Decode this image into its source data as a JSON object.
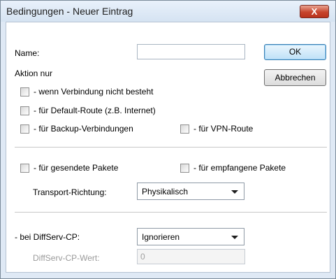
{
  "window": {
    "title": "Bedingungen - Neuer Eintrag",
    "close_label": "X"
  },
  "form": {
    "name_label": "Name:",
    "name_value": "",
    "ok_label": "OK",
    "cancel_label": "Abbrechen",
    "action_heading": "Aktion nur",
    "checks": {
      "no_connection": {
        "label": "- wenn Verbindung nicht besteht",
        "checked": false
      },
      "default_route": {
        "label": "- für Default-Route (z.B. Internet)",
        "checked": false
      },
      "backup": {
        "label": "- für Backup-Verbindungen",
        "checked": false
      },
      "vpn_route": {
        "label": "- für VPN-Route",
        "checked": false
      },
      "sent": {
        "label": "- für gesendete Pakete",
        "checked": false
      },
      "received": {
        "label": "- für empfangene Pakete",
        "checked": false
      }
    },
    "transport_label": "Transport-Richtung:",
    "transport_value": "Physikalisch",
    "diffserv_label": "- bei DiffServ-CP:",
    "diffserv_value": "Ignorieren",
    "diffserv_value_label": "DiffServ-CP-Wert:",
    "diffserv_value_value": "0"
  }
}
